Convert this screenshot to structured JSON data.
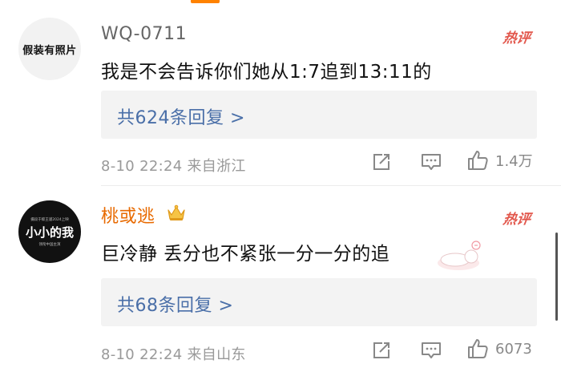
{
  "comments": [
    {
      "avatar_text": "假装有照片",
      "username": "WQ-0711",
      "hot_label": "热评",
      "content": "我是不会告诉你们她从1:7追到13:11的",
      "reply_label": "共624条回复 >",
      "meta": "8-10 22:24 来自浙江",
      "like_count": "1.4万"
    },
    {
      "avatar_top": "摄段于鲸王谨2024上映",
      "avatar_big": "小小的我",
      "avatar_bottom": "领衔中国主演",
      "username": "桃或逃",
      "hot_label": "热评",
      "content": "巨冷静 丢分也不紧张一分一分的追",
      "reply_label": "共68条回复 >",
      "meta": "8-10 22:24 来自山东",
      "like_count": "6073"
    }
  ],
  "colors": {
    "username_vip": "#e86a00",
    "link": "#4a6fa8",
    "hot": "#e2574c",
    "accent": "#ff8200"
  },
  "icons": [
    "share-icon",
    "reply-icon",
    "like-icon",
    "crown-icon"
  ]
}
